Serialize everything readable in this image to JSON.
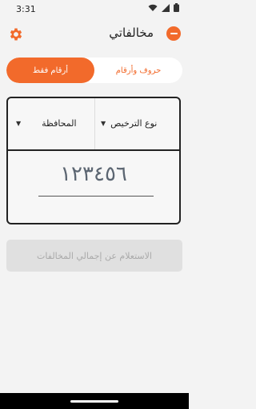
{
  "status_bar": {
    "time": "3:31"
  },
  "app_bar": {
    "title": "مخالفاتي"
  },
  "segmented": {
    "left_label": "أرقام فقط",
    "right_label": "حروف وأرقام"
  },
  "plate": {
    "governorate_label": "المحافظة",
    "license_type_label": "نوع الترخيص",
    "number_value": "١٢٣٤٥٦"
  },
  "actions": {
    "query_label": "الاستعلام عن إجمالي المخالفات"
  },
  "colors": {
    "accent": "#f26a2b",
    "disabled_bg": "#e0e0e0",
    "disabled_text": "#aaaaaa"
  }
}
